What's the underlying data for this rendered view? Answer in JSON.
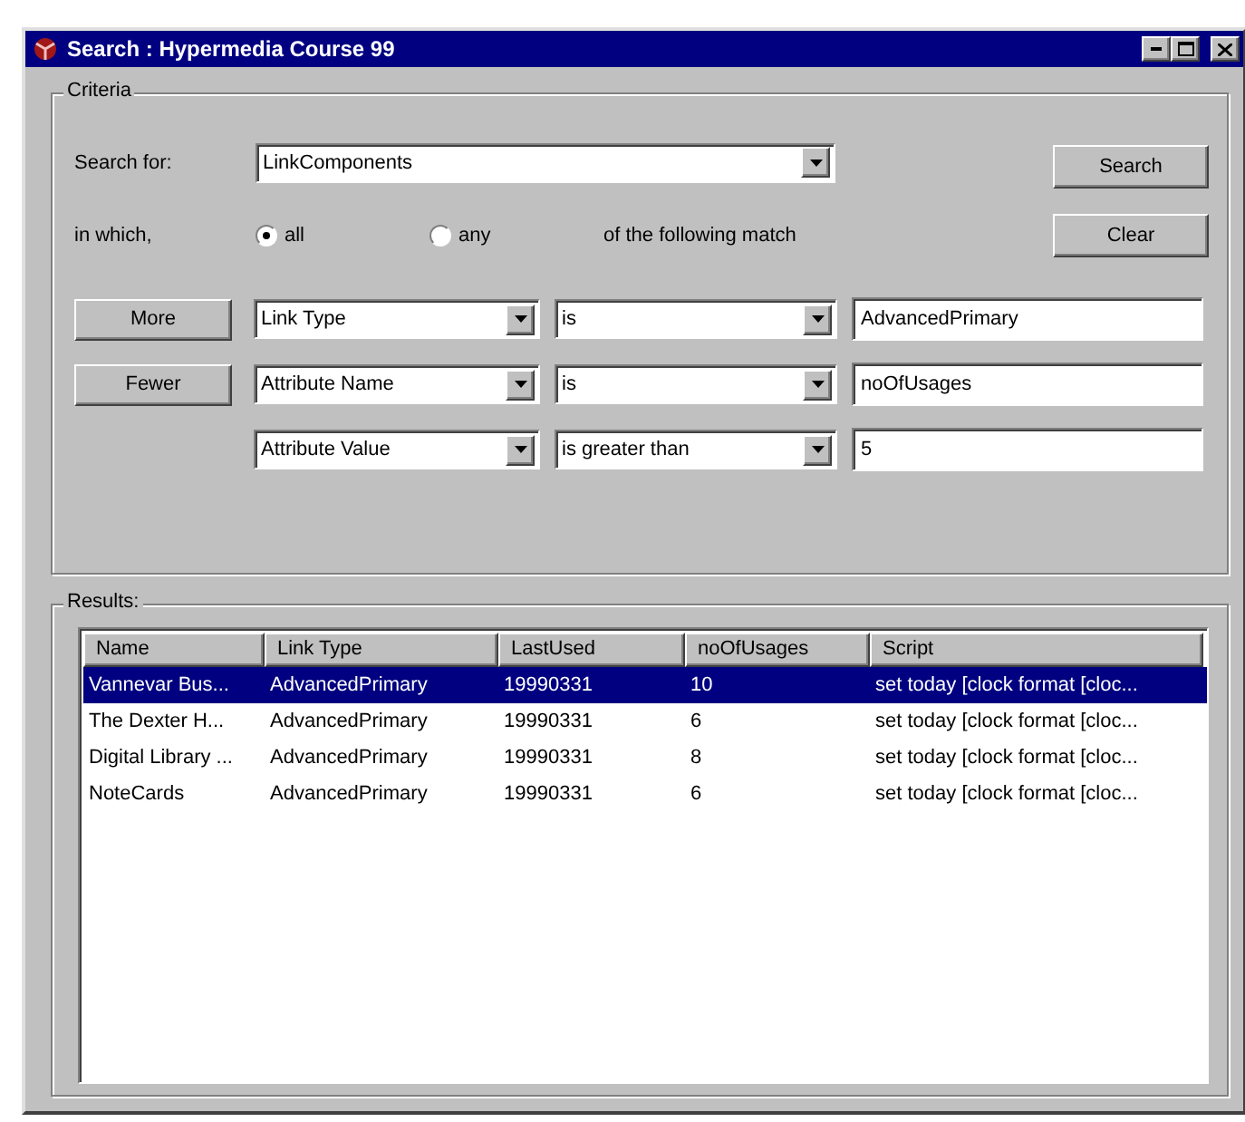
{
  "window": {
    "title": "Search : Hypermedia Course 99"
  },
  "criteria": {
    "legend": "Criteria",
    "search_for_label": "Search for:",
    "search_for": "LinkComponents",
    "in_which_label": "in which,",
    "match_options": [
      {
        "label": "all",
        "selected": true
      },
      {
        "label": "any",
        "selected": false
      }
    ],
    "match_suffix": "of the following match",
    "buttons": [
      "Search",
      "Clear"
    ],
    "conditions": [
      {
        "button": "More",
        "attribute": "Link Type",
        "operator": "is",
        "value": "AdvancedPrimary"
      },
      {
        "button": "Fewer",
        "attribute": "Attribute Name",
        "operator": "is",
        "value": "noOfUsages"
      },
      {
        "attribute": "Attribute Value",
        "operator": "is greater than",
        "value": "5"
      }
    ]
  },
  "results": {
    "legend": "Results:",
    "columns": [
      "Name",
      "Link Type",
      "LastUsed",
      "noOfUsages",
      "Script"
    ],
    "rows": [
      {
        "cells": [
          "Vannevar Bus...",
          "AdvancedPrimary",
          "19990331",
          "10",
          "set today [clock format [cloc..."
        ],
        "selected": true
      },
      {
        "cells": [
          "The Dexter H...",
          "AdvancedPrimary",
          "19990331",
          "6",
          "set today [clock format [cloc..."
        ],
        "selected": false
      },
      {
        "cells": [
          "Digital Library ...",
          "AdvancedPrimary",
          "19990331",
          "8",
          "set today [clock format [cloc..."
        ],
        "selected": false
      },
      {
        "cells": [
          "NoteCards",
          "AdvancedPrimary",
          "19990331",
          "6",
          "set today [clock format [cloc..."
        ],
        "selected": false
      }
    ]
  }
}
